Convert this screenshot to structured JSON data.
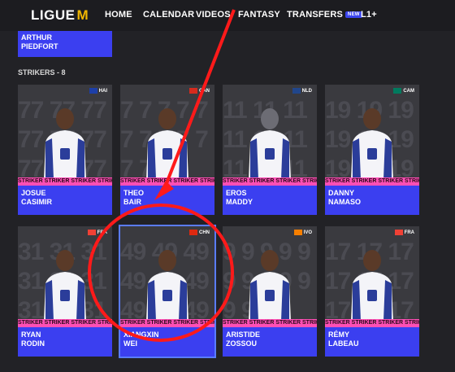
{
  "header": {
    "logo": "LIGUE",
    "nav": [
      "HOME",
      "CALENDAR",
      "VIDEOS",
      "FANTASY",
      "TRANSFERS",
      "L1+"
    ],
    "badge": "NEW"
  },
  "prev_player": {
    "first": "ARTHUR",
    "last": "PIEDFORT"
  },
  "section_title": "STRIKERS - 8",
  "strip_text": "STRIKER STRIKER STRIKER STRIKER STRIKER",
  "players": [
    {
      "first": "JOSUE",
      "last": "CASIMIR",
      "country": "HAI",
      "flag": "#1d3fa8",
      "num": "77"
    },
    {
      "first": "THEO",
      "last": "BAIR",
      "country": "CAN",
      "flag": "#d52b1e",
      "num": "7"
    },
    {
      "first": "EROS",
      "last": "MADDY",
      "country": "NLD",
      "flag": "#21468b",
      "num": "11"
    },
    {
      "first": "DANNY",
      "last": "NAMASO",
      "country": "CAM",
      "flag": "#007a5e",
      "num": "19"
    },
    {
      "first": "RYAN",
      "last": "RODIN",
      "country": "FRA",
      "flag": "#ef4135",
      "num": "31"
    },
    {
      "first": "XIANGXIN",
      "last": "WEI",
      "country": "CHN",
      "flag": "#de2910",
      "num": "49"
    },
    {
      "first": "ARISTIDE",
      "last": "ZOSSOU",
      "country": "IVO",
      "flag": "#f77f00",
      "num": "9"
    },
    {
      "first": "RÉMY",
      "last": "LABEAU",
      "country": "FRA",
      "flag": "#ef4135",
      "num": "17"
    }
  ],
  "colors": {
    "accent": "#3b3ff0",
    "strip": "#ff4fb5",
    "annotation": "#ff1a1a"
  }
}
